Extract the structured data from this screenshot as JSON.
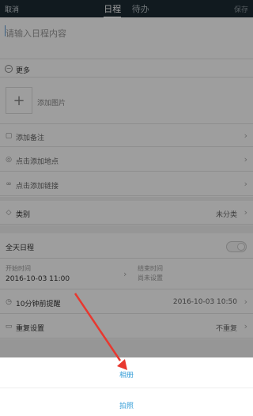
{
  "header": {
    "cancel_label": "取消",
    "save_label": "保存",
    "tabs": [
      {
        "label": "日程",
        "active": true
      },
      {
        "label": "待办",
        "active": false
      }
    ]
  },
  "form": {
    "content_placeholder": "请输入日程内容",
    "more_label": "更多",
    "add_image_label": "添加图片",
    "add_note_label": "添加备注",
    "add_location_label": "点击添加地点",
    "add_link_label": "点击添加链接",
    "category_label": "类别",
    "category_value": "未分类",
    "all_day_label": "全天日程",
    "start_time_label": "开始时间",
    "start_time_value": "2016-10-03 11:00",
    "end_time_label": "结束时间",
    "end_time_value": "尚未设置",
    "reminder_label": "10分钟前提醒",
    "reminder_value": "2016-10-03 10:50",
    "repeat_label": "重复设置",
    "repeat_value": "不重复"
  },
  "sheet": {
    "album_label": "相册",
    "camera_label": "拍照"
  },
  "colors": {
    "topbar": "#1c2a33",
    "accent": "#3aa0d8",
    "arrow": "#e8382f"
  }
}
